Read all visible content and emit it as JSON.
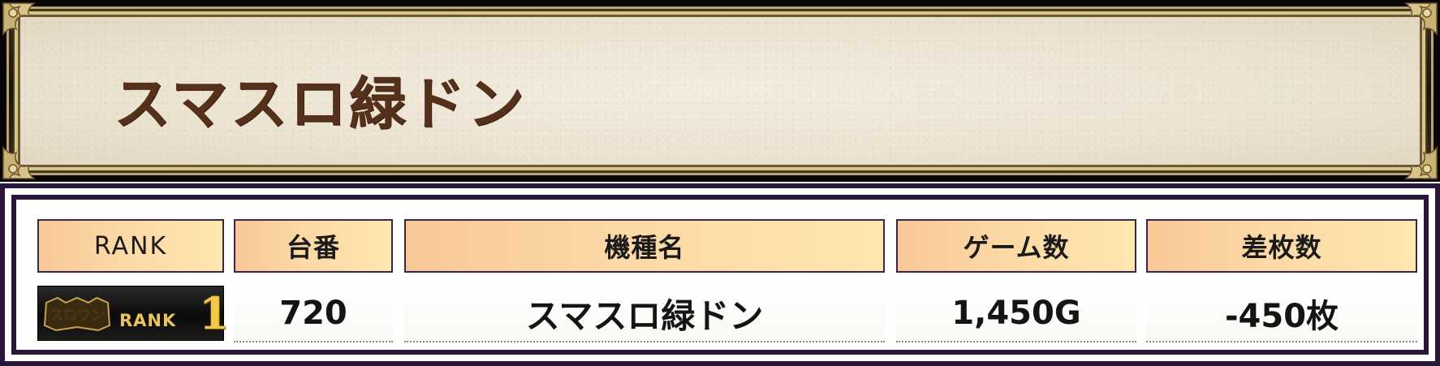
{
  "banner": {
    "title": "スマスロ緑ドン"
  },
  "table": {
    "headers": {
      "rank": "RANK",
      "machine_no": "台番",
      "model_name": "機種名",
      "games": "ゲーム数",
      "diff": "差枚数"
    },
    "rows": [
      {
        "rank_badge": {
          "logo_text": "スロワン",
          "label": "RANK",
          "number": "1"
        },
        "machine_no": "720",
        "model_name": "スマスロ緑ドン",
        "games": "1,450G",
        "diff": "-450枚"
      }
    ]
  },
  "colors": {
    "banner_title": "#55301a",
    "frame_gold": "#d8c58a",
    "panel_border": "#2a1638",
    "header_gradient_start": "#f8c898",
    "header_gradient_end": "#ffe6b0",
    "rank_gold": "#f2c94c"
  }
}
